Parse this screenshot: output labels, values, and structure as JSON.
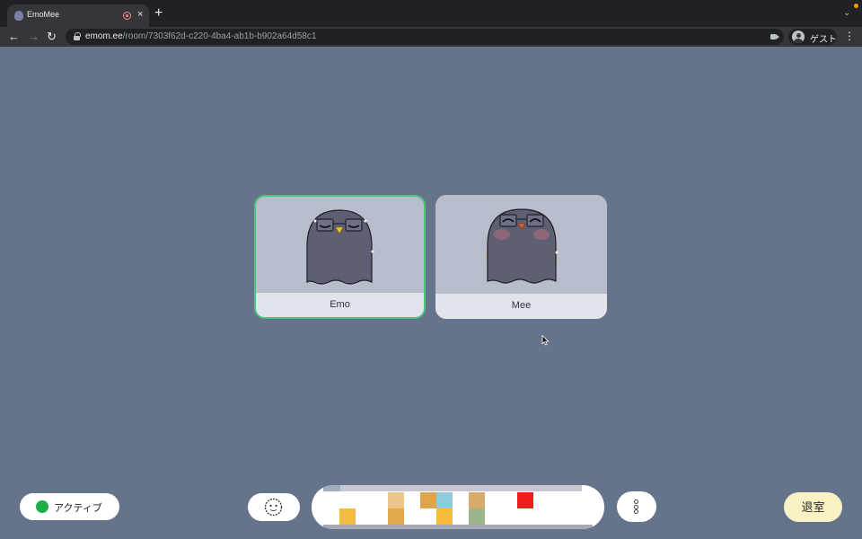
{
  "browser": {
    "tab_title": "EmoMee",
    "tab_close_glyph": "×",
    "new_tab_glyph": "+",
    "url_host": "emom.ee",
    "url_path": "/room/7303f62d-c220-4ba4-ab1b-b902a64d58c1",
    "profile_label": "ゲスト",
    "icons": [
      "favicon",
      "recording-icon",
      "back-arrow-icon",
      "forward-arrow-icon",
      "reload-icon",
      "lock-icon",
      "camera-icon",
      "profile-icon",
      "kebab-menu-icon",
      "tab-list-icon"
    ]
  },
  "participants": [
    {
      "name": "Emo",
      "active_speaker": true,
      "expression": "sleepy"
    },
    {
      "name": "Mee",
      "active_speaker": false,
      "expression": "happy"
    }
  ],
  "controls": {
    "status_label": "アクティブ",
    "status_color": "#1fae4c",
    "emoji_icon": "face-icon",
    "more_icon": "more-vertical-icon",
    "leave_label": "退室"
  },
  "colors": {
    "background": "#65748b",
    "active_border": "#4cc27e",
    "leave_button": "#f8f2c5"
  }
}
